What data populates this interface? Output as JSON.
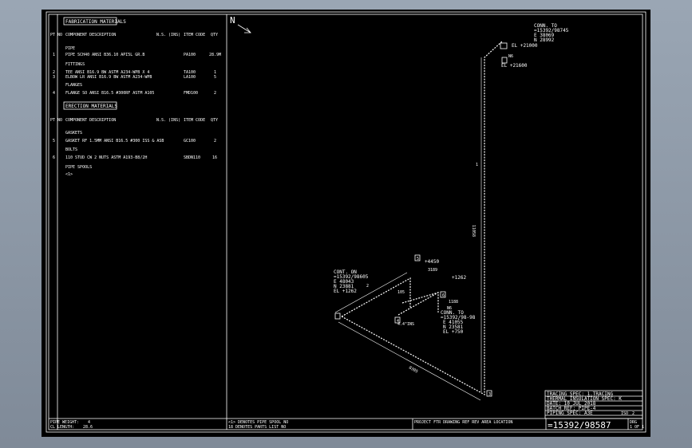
{
  "bom": {
    "fab_header": "FABRICATION MATERIALS",
    "pt_no": "PT NO",
    "col_desc": "COMPONENT DESCRIPTION",
    "col_ns": "N.S. (INS)",
    "col_code": "ITEM CODE",
    "col_qty": "QTY",
    "sections": [
      {
        "name": "PIPE",
        "rows": [
          {
            "pt": "1",
            "desc": "PIPE SCH40 ANSI B36.10 API5L GR.B",
            "code": "PA100",
            "qty": "28.9M"
          }
        ]
      },
      {
        "name": "FITTINGS",
        "rows": [
          {
            "pt": "2",
            "desc": "TEE ANSI B16.9 BW ASTM A234-WPB X 4",
            "code": "TA100",
            "qty": "1"
          },
          {
            "pt": "3",
            "desc": "ELBOW LR ANSI B16.9 BW ASTM A234-WPB",
            "code": "LA100",
            "qty": "5"
          }
        ]
      },
      {
        "name": "FLANGES",
        "rows": [
          {
            "pt": "4",
            "desc": "FLANGE SO ANSI B16.5 #300RF ASTM A105",
            "code": "FMD100",
            "qty": "2"
          }
        ]
      }
    ],
    "erection_header": "ERECTION MATERIALS",
    "erection_sections": [
      {
        "name": "GASKETS",
        "rows": [
          {
            "pt": "5",
            "desc": "GASKET RF 1.5MM ANSI B16.5 #300 ISS & ASB",
            "code": "GC100",
            "qty": "2"
          }
        ]
      },
      {
        "name": "BOLTS",
        "rows": [
          {
            "pt": "6",
            "desc": "110 STUD CW 2 NUTS ASTM A193-B8/2H",
            "code": "SBDN110",
            "qty": "16"
          }
        ]
      },
      {
        "name": "PIPE SPOOLS",
        "rows": [
          {
            "pt": "",
            "desc": "<1>",
            "code": "",
            "qty": ""
          }
        ]
      }
    ],
    "footer_weight": "PIPE WEIGHT:",
    "footer_weight_val": "4",
    "footer_length": "CL LENGTH:",
    "footer_length_val": "28.6"
  },
  "notes": {
    "line1": "<1> DENOTES PIPE SPOOL NO",
    "line2": "18 DENOTES PARTS LIST NO"
  },
  "north": "N",
  "titleblock": {
    "tracing": "TRACING SPEC: 1.TRACING",
    "insulation": "THERMAL INSULATION SPEC: K",
    "date": "DATE: 10 JUL 2018",
    "batch": "BATCH REF: PIPE-4",
    "piping": "PIPING SPEC: A3E",
    "iso_label": "ISO",
    "iso_val": "2",
    "line_no": "=15392/98587",
    "drg": "DRG",
    "sheet": "1 OF 1",
    "headers": "PROJECT FTR DRAWING REF REV AREA LOCATION"
  },
  "annotations": {
    "conn_top": "CONN. TO",
    "conn_top_ref": "=15392/98745",
    "top_e": "E 38069",
    "top_n": "N 28992",
    "top_el": "EL +21000",
    "top_n2": "N6",
    "el_21600": "EL +21600",
    "dim_vert": "11058",
    "dim_long": "8305",
    "cont_on": "CONT. ON",
    "cont_ref": "=15392/98605",
    "cont_e": "E 48043",
    "cont_n": "N 23881",
    "cont_el": "EL +1262",
    "el_4450": "+4450",
    "dim_3189": "3189",
    "el_1262": "+1262",
    "dim_105": "105",
    "dim_1188": "1188",
    "mk_n6": "N6",
    "conn_to2": "CONN. TO",
    "conn_to2_ref": "=15392/98-98",
    "c2_e": "E 41055",
    "c2_n": "N 23581",
    "c2_el": "EL +750",
    "ins": "4.4\"INS",
    "p5": "5",
    "p6": "6",
    "p4": "4",
    "p1": "1",
    "p3": "3",
    "p2": "2"
  }
}
